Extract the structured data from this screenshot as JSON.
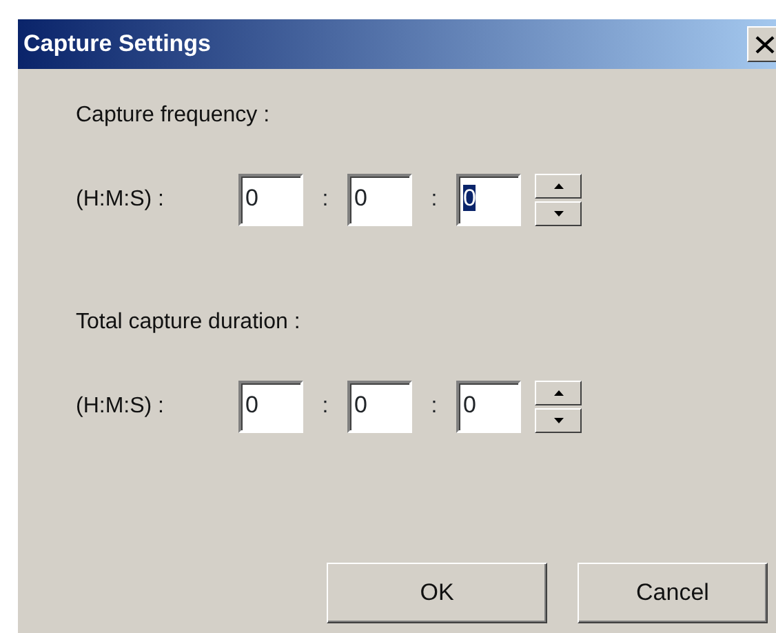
{
  "window": {
    "title": "Capture Settings"
  },
  "sections": [
    {
      "label": "Capture frequency :",
      "row_label": "(H:M:S) :",
      "fields": [
        {
          "value": "0",
          "selected": false
        },
        {
          "value": "0",
          "selected": false
        },
        {
          "value": "0",
          "selected": true
        }
      ],
      "separators": [
        ":",
        ":"
      ]
    },
    {
      "label": "Total capture duration :",
      "row_label": "(H:M:S) :",
      "fields": [
        {
          "value": "0",
          "selected": false
        },
        {
          "value": "0",
          "selected": false
        },
        {
          "value": "0",
          "selected": false
        }
      ],
      "separators": [
        ":",
        ":"
      ]
    }
  ],
  "buttons": [
    "OK",
    "Cancel"
  ]
}
